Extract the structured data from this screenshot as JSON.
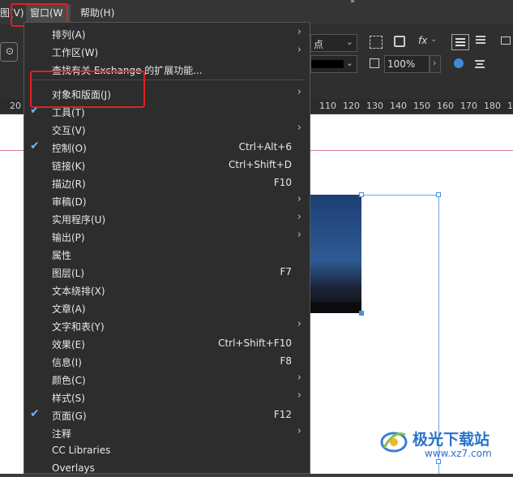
{
  "menubar": {
    "partial_left": "图(V)",
    "window_menu": "窗口(W",
    "help_menu": "帮助(H)"
  },
  "toolbar": {
    "point_unit": "点",
    "zoom_value": "100%",
    "fx_label": "fx"
  },
  "ruler": {
    "left_tick": "20",
    "ticks": [
      "110",
      "120",
      "130",
      "140",
      "150",
      "160",
      "170",
      "180",
      "19"
    ]
  },
  "menu": {
    "items": [
      {
        "label": "排列(A)",
        "shortcut": "",
        "submenu": true,
        "checked": false
      },
      {
        "label": "工作区(W)",
        "shortcut": "",
        "submenu": true,
        "checked": false
      },
      {
        "label": "查找有关 Exchange 的扩展功能...",
        "shortcut": "",
        "submenu": false,
        "checked": false
      },
      {
        "label": "对象和版面(J)",
        "shortcut": "",
        "submenu": true,
        "checked": false
      },
      {
        "label": "工具(T)",
        "shortcut": "",
        "submenu": false,
        "checked": true
      },
      {
        "label": "交互(V)",
        "shortcut": "",
        "submenu": true,
        "checked": false
      },
      {
        "label": "控制(O)",
        "shortcut": "Ctrl+Alt+6",
        "submenu": false,
        "checked": true
      },
      {
        "label": "链接(K)",
        "shortcut": "Ctrl+Shift+D",
        "submenu": false,
        "checked": false
      },
      {
        "label": "描边(R)",
        "shortcut": "F10",
        "submenu": false,
        "checked": false
      },
      {
        "label": "审稿(D)",
        "shortcut": "",
        "submenu": true,
        "checked": false
      },
      {
        "label": "实用程序(U)",
        "shortcut": "",
        "submenu": true,
        "checked": false
      },
      {
        "label": "输出(P)",
        "shortcut": "",
        "submenu": true,
        "checked": false
      },
      {
        "label": "属性",
        "shortcut": "",
        "submenu": false,
        "checked": false
      },
      {
        "label": "图层(L)",
        "shortcut": "F7",
        "submenu": false,
        "checked": false
      },
      {
        "label": "文本绕排(X)",
        "shortcut": "",
        "submenu": false,
        "checked": false
      },
      {
        "label": "文章(A)",
        "shortcut": "",
        "submenu": false,
        "checked": false
      },
      {
        "label": "文字和表(Y)",
        "shortcut": "",
        "submenu": true,
        "checked": false
      },
      {
        "label": "效果(E)",
        "shortcut": "Ctrl+Shift+F10",
        "submenu": false,
        "checked": false
      },
      {
        "label": "信息(I)",
        "shortcut": "F8",
        "submenu": false,
        "checked": false
      },
      {
        "label": "颜色(C)",
        "shortcut": "",
        "submenu": true,
        "checked": false
      },
      {
        "label": "样式(S)",
        "shortcut": "",
        "submenu": true,
        "checked": false
      },
      {
        "label": "页面(G)",
        "shortcut": "F12",
        "submenu": false,
        "checked": true
      },
      {
        "label": "注释",
        "shortcut": "",
        "submenu": true,
        "checked": false
      },
      {
        "label": "CC Libraries",
        "shortcut": "",
        "submenu": false,
        "checked": false
      },
      {
        "label": "Overlays",
        "shortcut": "",
        "submenu": false,
        "checked": false
      }
    ]
  },
  "watermark": {
    "title": "极光下载站",
    "url": "www.xz7.com"
  },
  "colors": {
    "highlight_red": "#e02020",
    "check_blue": "#6db3ff",
    "menu_bg": "#2d2d2d"
  }
}
